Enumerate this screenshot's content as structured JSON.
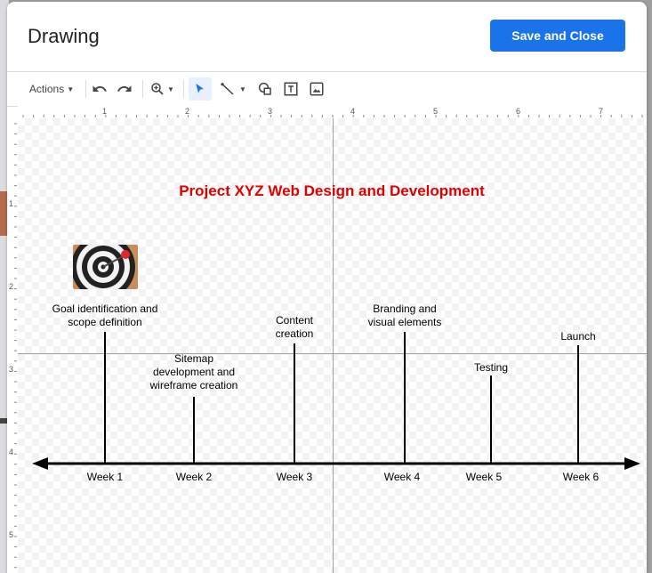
{
  "dialog": {
    "title": "Drawing",
    "save_label": "Save and Close"
  },
  "toolbar": {
    "actions_label": "Actions"
  },
  "ruler": {
    "h_numbers": [
      "1",
      "2",
      "3",
      "4",
      "5",
      "6",
      "7"
    ],
    "v_numbers": [
      "1",
      "2",
      "3",
      "4",
      "5"
    ]
  },
  "drawing": {
    "title": "Project XYZ Web Design and Development",
    "title_color": "#e00000",
    "weeks": [
      "Week 1",
      "Week 2",
      "Week 3",
      "Week 4",
      "Week 5",
      "Week 6"
    ],
    "milestones": [
      "Goal identification and scope definition",
      "Sitemap development and wireframe creation",
      "Content creation",
      "Branding and visual elements",
      "Testing",
      "Launch"
    ],
    "milestone_lines": {
      "l1": "Goal identification and",
      "l1b": "scope definition",
      "l2": "Sitemap",
      "l2b": "development and",
      "l2c": "wireframe creation",
      "l3": "Content",
      "l3b": "creation",
      "l4": "Branding and",
      "l4b": "visual elements",
      "l5": "Testing",
      "l6": "Launch"
    }
  },
  "colors": {
    "accent": "#1a73e8"
  }
}
